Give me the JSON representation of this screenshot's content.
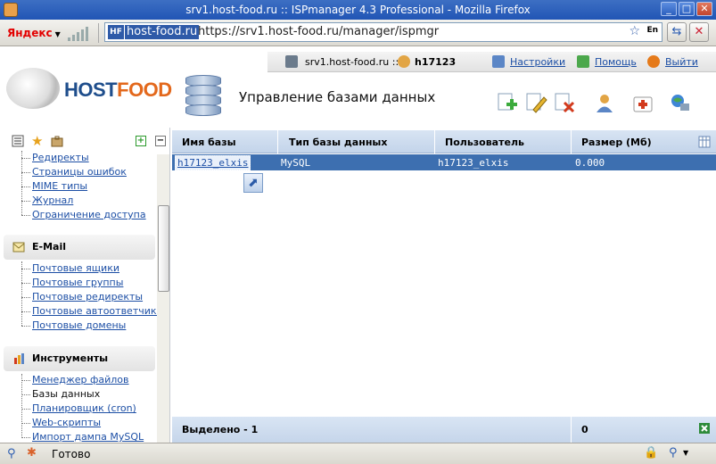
{
  "window": {
    "title": "srv1.host-food.ru :: ISPmanager 4.3 Professional - Mozilla Firefox"
  },
  "toolbar": {
    "yandex_label": "Яндекс",
    "url_host": "host-food.ru",
    "url_full": "https://srv1.host-food.ru/manager/ispmgr",
    "favicon_text": "HF",
    "lang_badge": "En"
  },
  "header": {
    "server": "srv1.host-food.ru ::",
    "user": "h17123",
    "settings": "Настройки",
    "help": "Помощь",
    "logout": "Выйти",
    "logo_host": "HOST",
    "logo_food": "FOOD",
    "page_title": "Управление базами данных"
  },
  "sidebar": {
    "www_items": [
      "Редиректы",
      "Страницы ошибок",
      "MIME типы",
      "Журнал",
      "Ограничение доступа"
    ],
    "email_title": "E-Mail",
    "email_items": [
      "Почтовые ящики",
      "Почтовые группы",
      "Почтовые редиректы",
      "Почтовые автоответчики",
      "Почтовые домены"
    ],
    "tools_title": "Инструменты",
    "tools_items": [
      "Менеджер файлов",
      "Базы данных",
      "Планировщик (cron)",
      "Web-скрипты",
      "Импорт дампа MySQL"
    ]
  },
  "table": {
    "columns": [
      "Имя базы",
      "Тип базы данных",
      "Пользователь",
      "Размер (Мб)"
    ],
    "rows": [
      {
        "name": "h17123_elxis",
        "type": "MySQL",
        "user": "h17123_elxis",
        "size": "0.000"
      }
    ],
    "footer_label": "Выделено - 1",
    "footer_total": "0"
  },
  "status": {
    "text": "Готово"
  },
  "colors": {
    "titlebar": "#2155b5",
    "selected_row": "#3d6fb0",
    "link": "#1d4fa5",
    "logo_host": "#1f4e8c",
    "logo_food": "#e3681c"
  }
}
